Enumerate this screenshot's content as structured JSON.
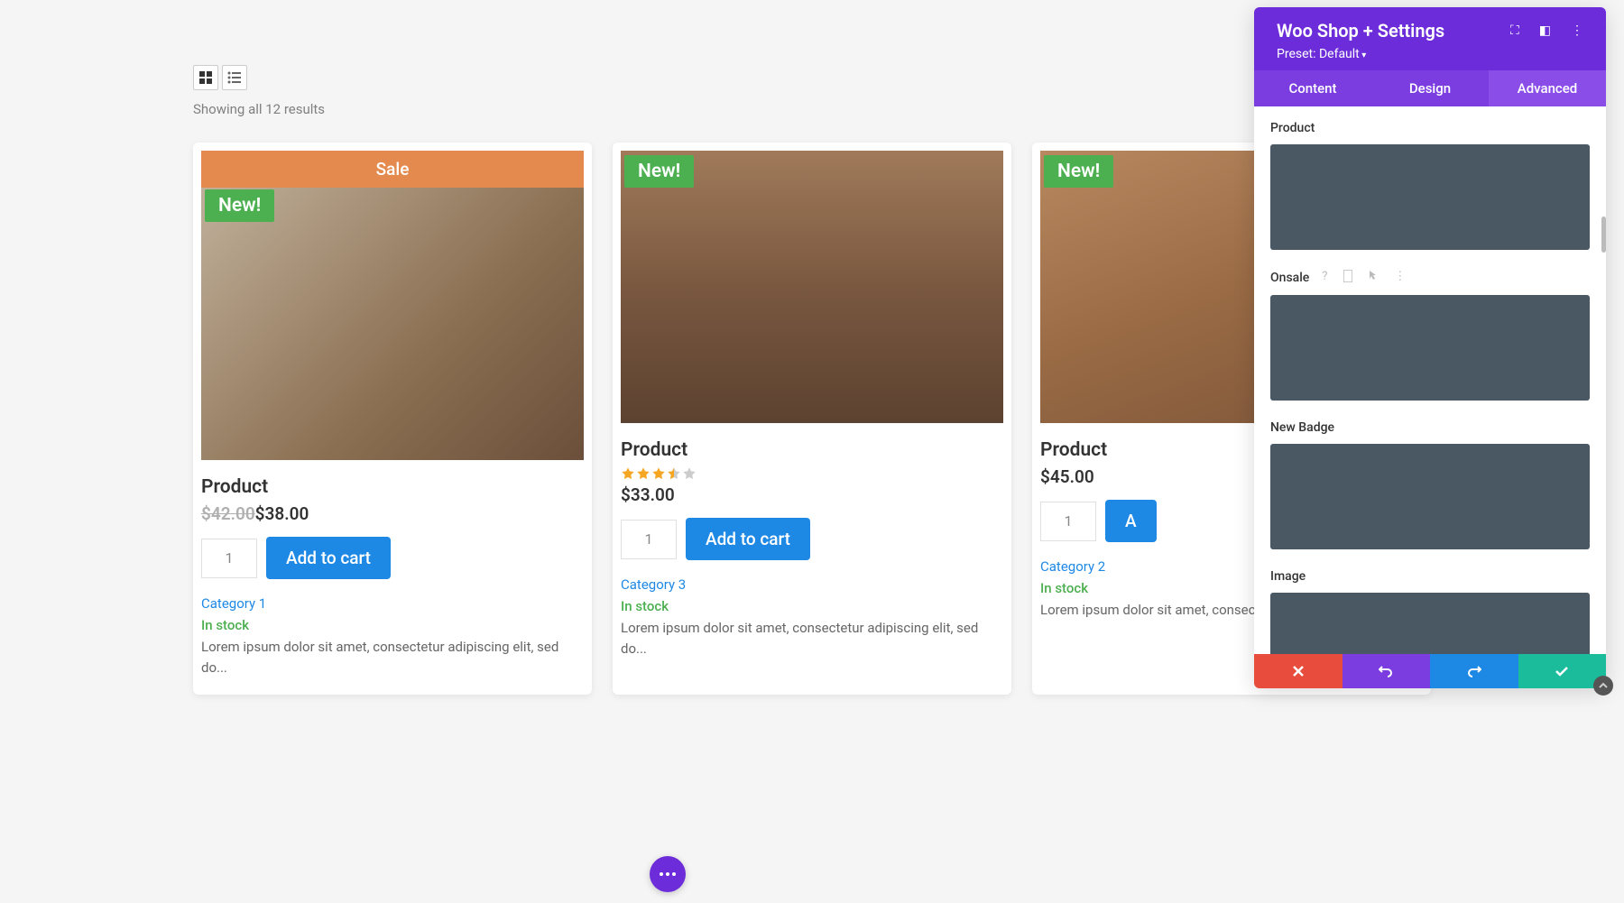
{
  "results_text": "Showing all 12 results",
  "sale_label": "Sale",
  "new_label": "New!",
  "products": [
    {
      "title": "Product",
      "old_price": "$42.00",
      "new_price": "$38.00",
      "qty": "1",
      "add_cart": "Add to cart",
      "category": "Category 1",
      "stock": "In stock",
      "desc": "Lorem ipsum dolor sit amet, consectetur adipiscing elit, sed do..."
    },
    {
      "title": "Product",
      "price": "$33.00",
      "qty": "1",
      "add_cart": "Add to cart",
      "category": "Category 3",
      "stock": "In stock",
      "desc": "Lorem ipsum dolor sit amet, consectetur adipiscing elit, sed do...",
      "rating": 3.5
    },
    {
      "title": "Product",
      "price": "$45.00",
      "qty": "1",
      "add_cart": "A",
      "category": "Category 2",
      "stock": "In stock",
      "desc": "Lorem ipsum dolor sit amet, consectetur adipiscing elit,"
    }
  ],
  "panel": {
    "title": "Woo Shop + Settings",
    "preset": "Preset: Default",
    "tabs": {
      "content": "Content",
      "design": "Design",
      "advanced": "Advanced"
    },
    "settings": {
      "product": "Product",
      "onsale": "Onsale",
      "new_badge": "New Badge",
      "image": "Image"
    },
    "hints": {
      "help": "?",
      "device": "📱",
      "pointer": "↖",
      "menu": "⋮"
    }
  }
}
